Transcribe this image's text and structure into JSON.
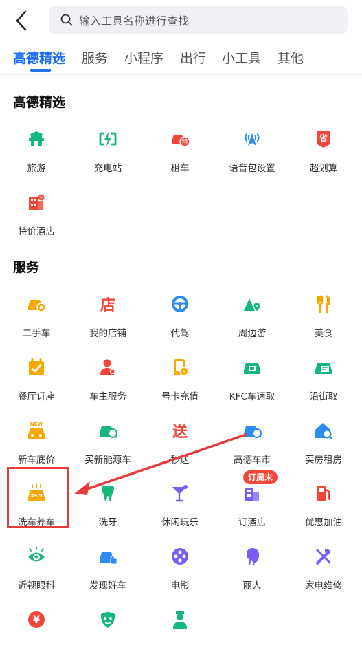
{
  "search": {
    "placeholder": "输入工具名称进行查找"
  },
  "tabs": [
    {
      "label": "高德精选"
    },
    {
      "label": "服务"
    },
    {
      "label": "小程序"
    },
    {
      "label": "出行"
    },
    {
      "label": "小工具"
    },
    {
      "label": "其他"
    }
  ],
  "sections": {
    "featured": {
      "title": "高德精选",
      "items": [
        {
          "label": "旅游",
          "icon": "pagoda-icon"
        },
        {
          "label": "充电站",
          "icon": "charging-icon"
        },
        {
          "label": "租车",
          "icon": "car-rental-icon"
        },
        {
          "label": "语音包设置",
          "icon": "voice-pack-icon"
        },
        {
          "label": "超划算",
          "icon": "deal-icon"
        },
        {
          "label": "特价酒店",
          "icon": "hotel-icon"
        }
      ]
    },
    "services": {
      "title": "服务",
      "items": [
        {
          "label": "二手车",
          "icon": "used-car-icon"
        },
        {
          "label": "我的店铺",
          "icon": "shop-icon"
        },
        {
          "label": "代驾",
          "icon": "steering-wheel-icon"
        },
        {
          "label": "周边游",
          "icon": "nearby-trip-icon"
        },
        {
          "label": "美食",
          "icon": "food-icon"
        },
        {
          "label": "餐厅订座",
          "icon": "reservation-icon"
        },
        {
          "label": "车主服务",
          "icon": "car-owner-icon"
        },
        {
          "label": "号卡充值",
          "icon": "phone-card-icon"
        },
        {
          "label": "KFC车速取",
          "icon": "kfc-pickup-icon"
        },
        {
          "label": "沿街取",
          "icon": "street-pickup-icon"
        },
        {
          "label": "新车底价",
          "icon": "new-car-icon"
        },
        {
          "label": "买新能源车",
          "icon": "ev-car-icon"
        },
        {
          "label": "秒送",
          "icon": "express-delivery-icon"
        },
        {
          "label": "高德车市",
          "icon": "car-market-icon"
        },
        {
          "label": "买房租房",
          "icon": "house-search-icon"
        },
        {
          "label": "洗车养车",
          "icon": "car-wash-icon"
        },
        {
          "label": "洗牙",
          "icon": "tooth-icon"
        },
        {
          "label": "休闲玩乐",
          "icon": "cocktail-icon"
        },
        {
          "label": "订酒店",
          "icon": "hotel-booking-icon"
        },
        {
          "label": "优惠加油",
          "icon": "fuel-icon"
        },
        {
          "label": "近视眼科",
          "icon": "eye-icon"
        },
        {
          "label": "发现好车",
          "icon": "good-car-icon"
        },
        {
          "label": "电影",
          "icon": "film-reel-icon"
        },
        {
          "label": "丽人",
          "icon": "beauty-icon"
        },
        {
          "label": "家电维修",
          "icon": "repair-icon"
        },
        {
          "label": "",
          "icon": "yuan-coin-icon"
        },
        {
          "label": "",
          "icon": "mask-icon"
        },
        {
          "label": "",
          "icon": "nurse-icon"
        }
      ]
    }
  },
  "badges": {
    "hotel_weekend": "订周末",
    "new": "NEW",
    "rent": "租",
    "save": "省",
    "shop": "店",
    "send": "送",
    "price": "¥9.9"
  },
  "colors": {
    "accent": "#1f6ff0",
    "green": "#16b77a",
    "red": "#f2463a",
    "orange": "#f7a800",
    "blue": "#2d8cf0",
    "purple": "#7b5cf5"
  }
}
